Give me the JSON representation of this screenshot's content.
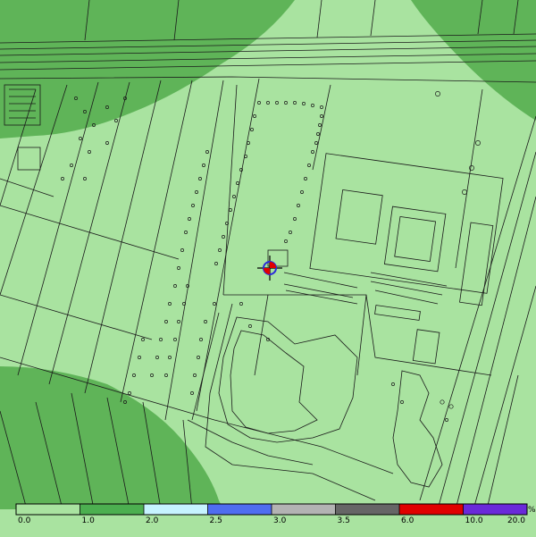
{
  "legend": {
    "unit": "%",
    "bins": [
      {
        "from": "0.0",
        "to": "1.0",
        "color": "#a9e3a0"
      },
      {
        "from": "1.0",
        "to": "2.0",
        "color": "#4caf50"
      },
      {
        "from": "2.0",
        "to": "2.5",
        "color": "#c6f3ff"
      },
      {
        "from": "2.5",
        "to": "3.0",
        "color": "#4f6df0"
      },
      {
        "from": "3.0",
        "to": "3.5",
        "color": "#b3b3b3"
      },
      {
        "from": "3.5",
        "to": "6.0",
        "color": "#666666"
      },
      {
        "from": "6.0",
        "to": "10.0",
        "color": "#e00000"
      },
      {
        "from": "10.0",
        "to": "20.0",
        "color": "#6a2ad9"
      }
    ],
    "tick_labels": [
      "0.0",
      "1.0",
      "2.0",
      "2.5",
      "3.0",
      "3.5",
      "6.0",
      "10.0",
      "20.0"
    ]
  },
  "map_colors": {
    "background_light": "#a9e3a0",
    "zone_dark": "#5fb458",
    "lines": "#1a1a1a"
  },
  "marker": {
    "name": "source-marker"
  }
}
